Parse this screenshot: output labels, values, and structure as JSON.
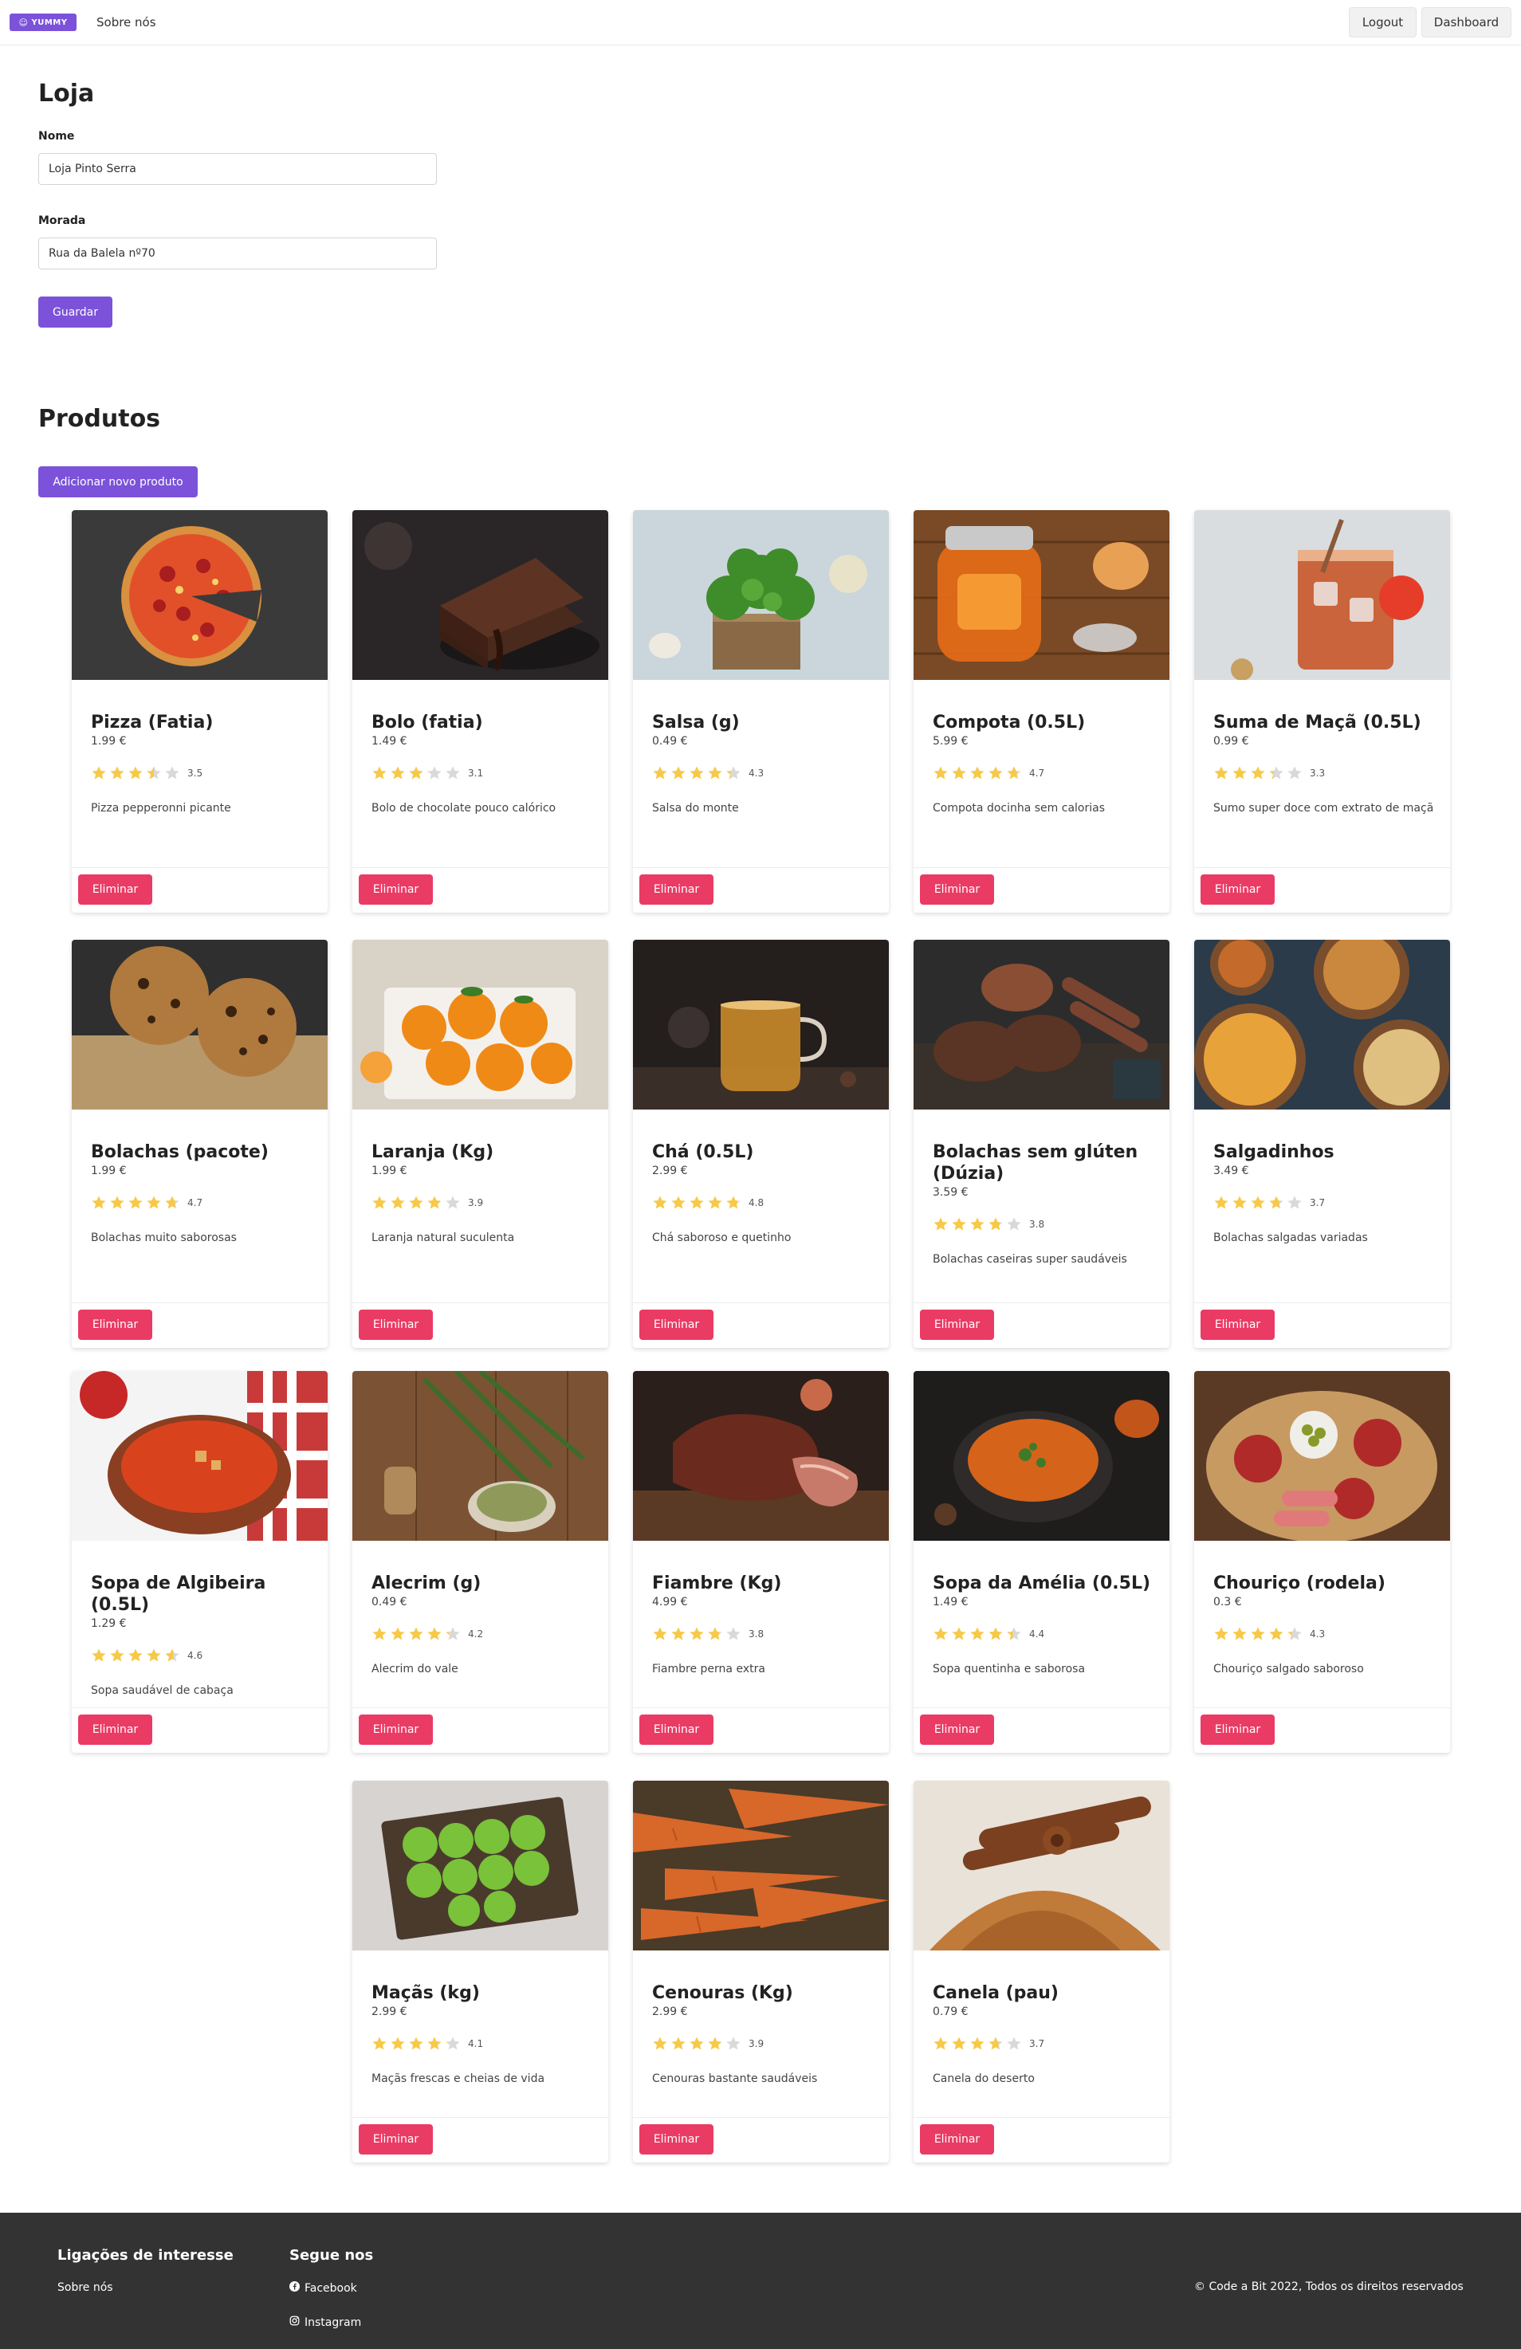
{
  "nav": {
    "logo_text": "YUMMY",
    "logo_icon": "smile-icon",
    "about_link": "Sobre nós",
    "logout": "Logout",
    "dashboard": "Dashboard"
  },
  "store": {
    "title": "Loja",
    "name_label": "Nome",
    "name_value": "Loja Pinto Serra",
    "address_label": "Morada",
    "address_value": "Rua da Balela nº70",
    "save_button": "Guardar"
  },
  "products": {
    "title": "Produtos",
    "add_button": "Adicionar novo produto",
    "delete_label": "Eliminar",
    "items": [
      {
        "name": "Pizza (Fatia)",
        "price": "1.99 €",
        "rating": 3.5,
        "rating_text": "3.5",
        "description": "Pizza pepperonni picante",
        "image": "pizza-photo"
      },
      {
        "name": "Bolo (fatia)",
        "price": "1.49 €",
        "rating": 3.1,
        "rating_text": "3.1",
        "description": "Bolo de chocolate pouco calórico",
        "image": "chocolate-cake-photo"
      },
      {
        "name": "Salsa (g)",
        "price": "0.49 €",
        "rating": 4.3,
        "rating_text": "4.3",
        "description": "Salsa do monte",
        "image": "parsley-photo"
      },
      {
        "name": "Compota (0.5L)",
        "price": "5.99 €",
        "rating": 4.7,
        "rating_text": "4.7",
        "description": "Compota docinha sem calorias",
        "image": "jam-jar-photo"
      },
      {
        "name": "Suma de Maçã (0.5L)",
        "price": "0.99 €",
        "rating": 3.3,
        "rating_text": "3.3",
        "description": "Sumo super doce com extrato de maçã",
        "image": "apple-juice-photo"
      },
      {
        "name": "Bolachas (pacote)",
        "price": "1.99 €",
        "rating": 4.7,
        "rating_text": "4.7",
        "description": "Bolachas muito saborosas",
        "image": "cookies-photo"
      },
      {
        "name": "Laranja (Kg)",
        "price": "1.99 €",
        "rating": 3.9,
        "rating_text": "3.9",
        "description": "Laranja natural suculenta",
        "image": "oranges-photo"
      },
      {
        "name": "Chá (0.5L)",
        "price": "2.99 €",
        "rating": 4.8,
        "rating_text": "4.8",
        "description": "Chá saboroso e quetinho",
        "image": "tea-photo"
      },
      {
        "name": "Bolachas sem glúten (Dúzia)",
        "price": "3.59 €",
        "rating": 3.8,
        "rating_text": "3.8",
        "description": "Bolachas caseiras super saudáveis",
        "image": "gluten-free-cookies-photo"
      },
      {
        "name": "Salgadinhos",
        "price": "3.49 €",
        "rating": 3.7,
        "rating_text": "3.7",
        "description": "Bolachas salgadas variadas",
        "image": "snacks-photo"
      },
      {
        "name": "Sopa de Algibeira (0.5L)",
        "price": "1.29 €",
        "rating": 4.6,
        "rating_text": "4.6",
        "description": "Sopa saudável de cabaça",
        "image": "tomato-soup-photo"
      },
      {
        "name": "Alecrim (g)",
        "price": "0.49 €",
        "rating": 4.2,
        "rating_text": "4.2",
        "description": "Alecrim do vale",
        "image": "rosemary-photo"
      },
      {
        "name": "Fiambre (Kg)",
        "price": "4.99 €",
        "rating": 3.8,
        "rating_text": "3.8",
        "description": "Fiambre perna extra",
        "image": "ham-photo"
      },
      {
        "name": "Sopa da Amélia (0.5L)",
        "price": "1.49 €",
        "rating": 4.4,
        "rating_text": "4.4",
        "description": "Sopa quentinha e saborosa",
        "image": "pumpkin-soup-photo"
      },
      {
        "name": "Chouriço (rodela)",
        "price": "0.3 €",
        "rating": 4.3,
        "rating_text": "4.3",
        "description": "Chouriço salgado saboroso",
        "image": "charcuterie-photo"
      },
      {
        "name": "Maçãs (kg)",
        "price": "2.99 €",
        "rating": 4.1,
        "rating_text": "4.1",
        "description": "Maçãs frescas e cheias de vida",
        "image": "green-apples-photo"
      },
      {
        "name": "Cenouras (Kg)",
        "price": "2.99 €",
        "rating": 3.9,
        "rating_text": "3.9",
        "description": "Cenouras bastante saudáveis",
        "image": "carrots-photo"
      },
      {
        "name": "Canela (pau)",
        "price": "0.79 €",
        "rating": 3.7,
        "rating_text": "3.7",
        "description": "Canela do deserto",
        "image": "cinnamon-photo"
      }
    ]
  },
  "footer": {
    "links_heading": "Ligações de interesse",
    "about_link": "Sobre nós",
    "social_heading": "Segue nos",
    "facebook": "Facebook",
    "instagram": "Instagram",
    "copyright": "© Code a Bit 2022, Todos os direitos reservados"
  },
  "colors": {
    "primary": "#7b52d9",
    "danger": "#ea3b64",
    "star": "#f7c948",
    "star_empty": "#d9d9d9",
    "footer_bg": "#333333"
  }
}
